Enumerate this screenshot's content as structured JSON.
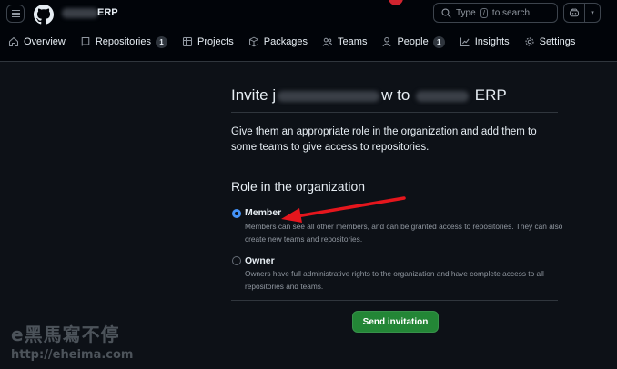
{
  "header": {
    "org_name": "ERP",
    "search_prefix": "Type",
    "search_key": "/",
    "search_suffix": "to search"
  },
  "nav": {
    "items": [
      {
        "label": "Overview"
      },
      {
        "label": "Repositories",
        "count": "1"
      },
      {
        "label": "Projects"
      },
      {
        "label": "Packages"
      },
      {
        "label": "Teams"
      },
      {
        "label": "People",
        "count": "1"
      },
      {
        "label": "Insights"
      },
      {
        "label": "Settings"
      }
    ]
  },
  "invite": {
    "title_prefix": "Invite j",
    "title_mid": "w to",
    "title_suffix": "ERP",
    "description": "Give them an appropriate role in the organization and add them to some teams to give access to repositories.",
    "role_heading": "Role in the organization",
    "roles": [
      {
        "label": "Member",
        "checked": true,
        "description": "Members can see all other members, and can be granted access to repositories. They can also create new teams and repositories."
      },
      {
        "label": "Owner",
        "checked": false,
        "description": "Owners have full administrative rights to the organization and have complete access to all repositories and teams."
      }
    ],
    "submit_label": "Send invitation"
  },
  "watermark": {
    "line1": "e黑馬寫不停",
    "line2": "http://eheima.com"
  },
  "colors": {
    "background": "#0d1117",
    "header_bg": "#010409",
    "accent_blue": "#4493f8",
    "button_green": "#238636",
    "arrow_red": "#e5161d"
  }
}
